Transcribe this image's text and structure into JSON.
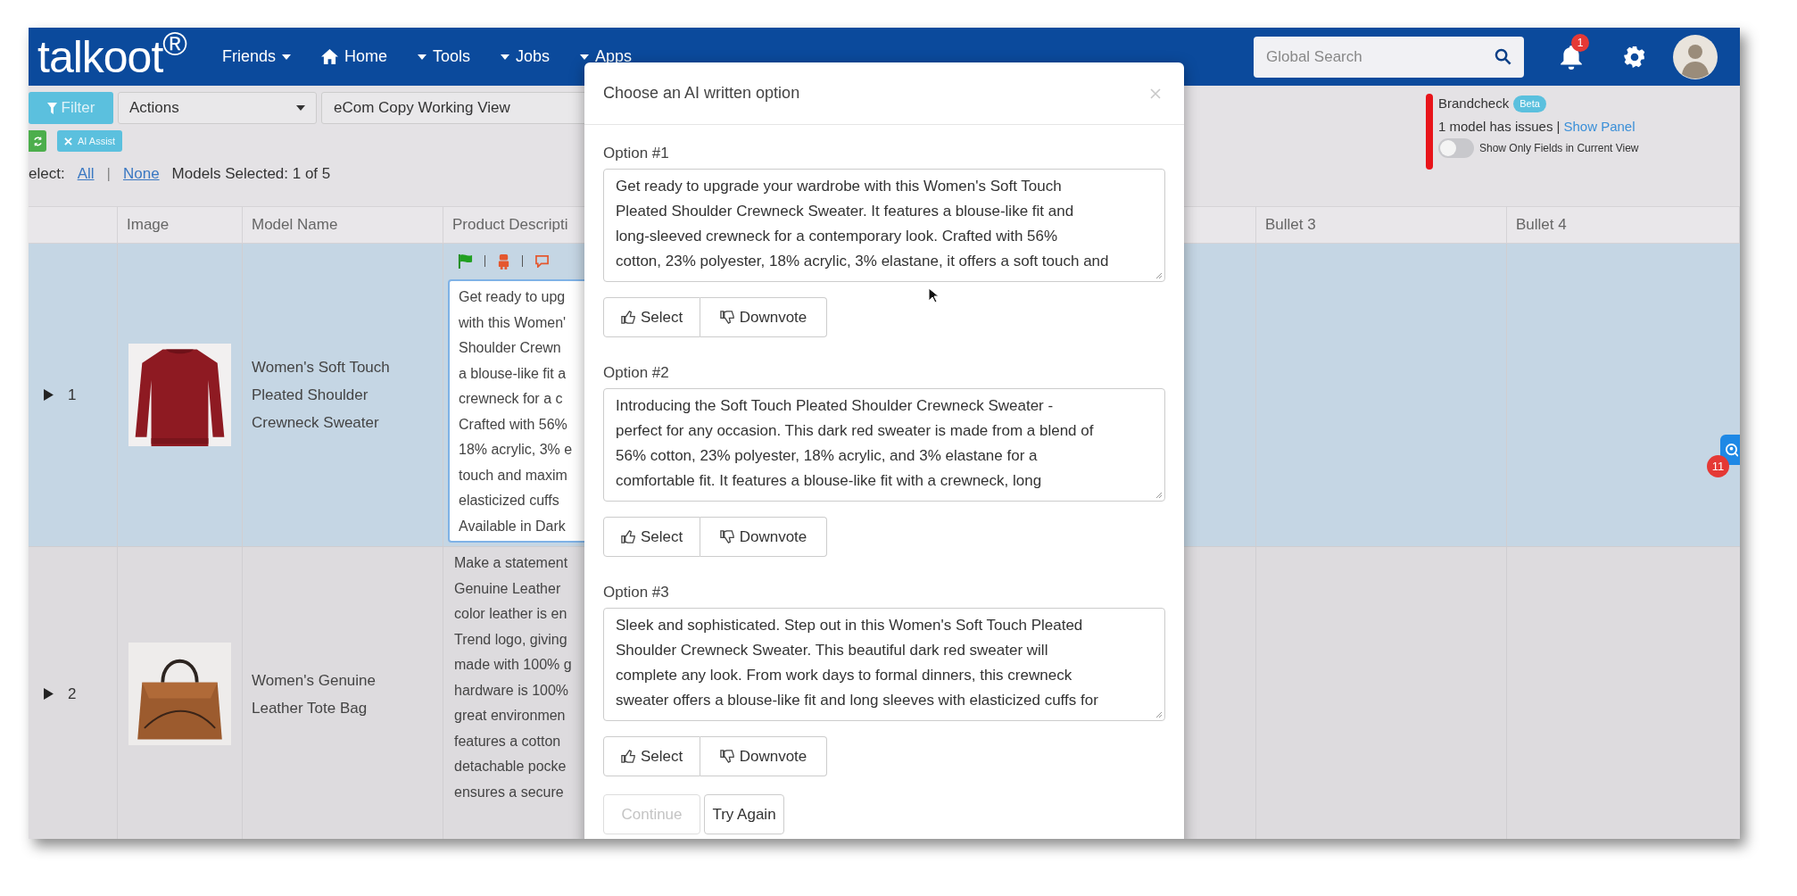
{
  "navbar": {
    "logo": "talkoot$^{®}$",
    "menu": [
      {
        "label": "Friends",
        "kind": "caret_after"
      },
      {
        "label": "Home",
        "kind": "home"
      },
      {
        "label": "Tools",
        "kind": "caret_before"
      },
      {
        "label": "Jobs",
        "kind": "caret_before"
      },
      {
        "label": "Apps",
        "kind": "caret_before"
      }
    ],
    "search": {
      "placeholder": "Global Search"
    },
    "notification_count": "1"
  },
  "toolbar": {
    "filter": "Filter",
    "actions": "Actions",
    "view": "eCom Copy Working View",
    "ai_assist": "AI Assist"
  },
  "selection": {
    "label": "elect:",
    "all": "All",
    "separator": "|",
    "none": "None",
    "summary": "Models Selected: 1 of 5"
  },
  "brandcheck": {
    "title": "Brandcheck",
    "badge": "Beta",
    "issues": "1 model has issues |",
    "link": "Show Panel",
    "toggle_label": "Show Only Fields in Current View",
    "toggle_on": false
  },
  "table": {
    "columns": [
      "Image",
      "Model Name",
      "Product Descripti",
      "Bullet 3",
      "Bullet 4"
    ],
    "rows": [
      {
        "number": "1",
        "selected": true,
        "editing": true,
        "model_name": "Women's Soft Touch Pleated Shoulder Crewneck Sweater",
        "description": "Get ready to upg\nwith this Women'\nShoulder Crewn\na blouse-like fit a\ncrewneck for a c\nCrafted with 56%\n18% acrylic, 3% e\ntouch and maxim\nelasticized cuffs\nAvailable in Dark"
      },
      {
        "number": "2",
        "selected": false,
        "editing": false,
        "model_name": "Women's Genuine Leather Tote Bag",
        "description": "Make a statement\nGenuine Leather\ncolor leather is en\nTrend logo, giving\nmade with 100% g\nhardware is 100%\ngreat environmen\nfeatures a cotton\ndetachable pocke\nensures a secure"
      }
    ]
  },
  "chat_badge": "11",
  "modal": {
    "title": "Choose an AI written option",
    "options": [
      {
        "label": "Option #1",
        "text": "Get ready to upgrade your wardrobe with this Women's Soft Touch\nPleated Shoulder Crewneck Sweater. It features a blouse-like fit and\nlong-sleeved crewneck for a contemporary look. Crafted with 56%\ncotton, 23% polyester, 18% acrylic, 3% elastane, it offers a soft touch and",
        "select": "Select",
        "downvote": "Downvote"
      },
      {
        "label": "Option #2",
        "text": "Introducing the Soft Touch Pleated Shoulder Crewneck Sweater -\nperfect for any occasion. This dark red sweater is made from a blend of\n56% cotton, 23% polyester, 18% acrylic, and 3% elastane for a\ncomfortable fit. It features a blouse-like fit with a crewneck, long",
        "select": "Select",
        "downvote": "Downvote"
      },
      {
        "label": "Option #3",
        "text": "Sleek and sophisticated. Step out in this Women's Soft Touch Pleated\nShoulder Crewneck Sweater. This beautiful dark red sweater will\ncomplete any look. From work days to formal dinners, this crewneck\nsweater offers a blouse-like fit and long sleeves with elasticized cuffs for",
        "select": "Select",
        "downvote": "Downvote"
      }
    ],
    "continue": {
      "label": "Continue",
      "disabled": true
    },
    "try_again": "Try Again"
  }
}
